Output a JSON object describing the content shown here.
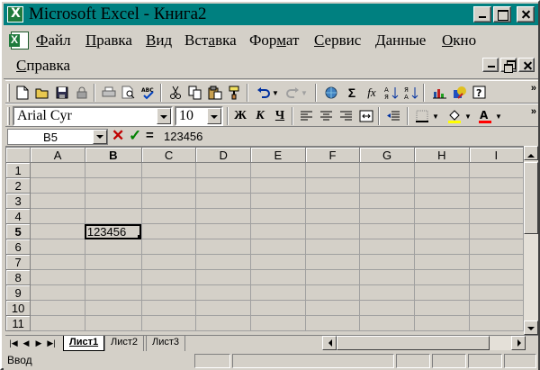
{
  "window": {
    "title": "Microsoft Excel - Книга2"
  },
  "menu": {
    "items": [
      {
        "label": "Файл",
        "ul": "Ф",
        "rest": "айл"
      },
      {
        "label": "Правка",
        "ul": "П",
        "rest": "равка"
      },
      {
        "label": "Вид",
        "ul": "В",
        "rest": "ид"
      },
      {
        "label": "Вставка",
        "pre": "Вст",
        "ul": "а",
        "rest": "вка"
      },
      {
        "label": "Формат",
        "pre": "Фор",
        "ul": "м",
        "rest": "ат"
      },
      {
        "label": "Сервис",
        "ul": "С",
        "rest": "ервис"
      },
      {
        "label": "Данные",
        "ul": "Д",
        "rest": "анные"
      },
      {
        "label": "Окно",
        "ul": "О",
        "rest": "кно"
      },
      {
        "label": "Справка",
        "ul": "С",
        "rest": "правка"
      }
    ]
  },
  "formatting": {
    "font_name": "Arial Cyr",
    "font_size": "10",
    "bold_label": "Ж",
    "italic_label": "К",
    "underline_label": "Ч",
    "autosum_label": "Σ",
    "function_label": "fx"
  },
  "formula_bar": {
    "name_box": "B5",
    "equals": "=",
    "content": "123456"
  },
  "sheet": {
    "columns": [
      "A",
      "B",
      "C",
      "D",
      "E",
      "F",
      "G",
      "H",
      "I"
    ],
    "rows": [
      "1",
      "2",
      "3",
      "4",
      "5",
      "6",
      "7",
      "8",
      "9",
      "10",
      "11"
    ],
    "active_column": "B",
    "active_row": "5",
    "cells": {
      "B5": "123456"
    }
  },
  "tabs": [
    "Лист1",
    "Лист2",
    "Лист3"
  ],
  "status": {
    "mode": "Ввод"
  },
  "colors": {
    "titlebar": "#008080",
    "face": "#d4d0c8"
  }
}
